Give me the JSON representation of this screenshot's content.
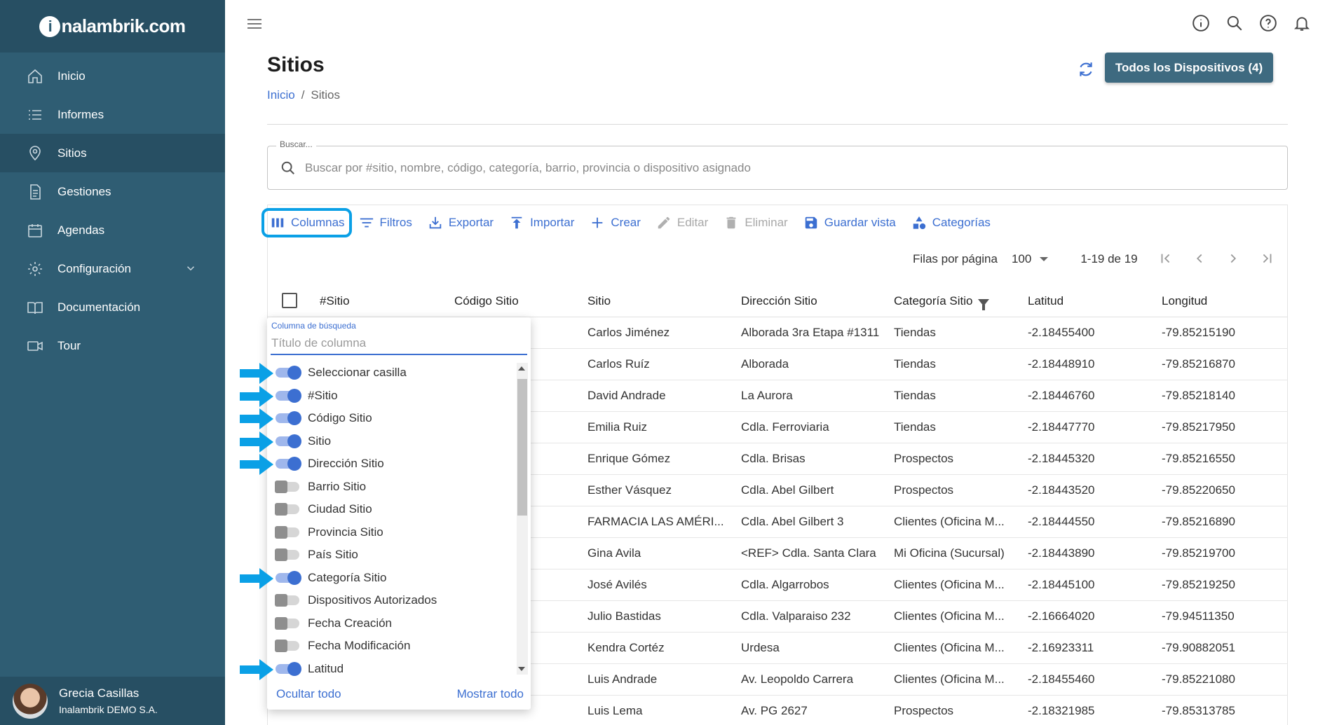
{
  "app": {
    "logo_text": "nalambrik.com",
    "logo_letter": "i"
  },
  "sidebar": {
    "items": [
      {
        "label": "Inicio",
        "icon": "home-icon"
      },
      {
        "label": "Informes",
        "icon": "list-icon"
      },
      {
        "label": "Sitios",
        "icon": "location-pin-icon",
        "active": true
      },
      {
        "label": "Gestiones",
        "icon": "document-icon"
      },
      {
        "label": "Agendas",
        "icon": "calendar-icon"
      },
      {
        "label": "Configuración",
        "icon": "gear-icon",
        "has_chevron": true
      },
      {
        "label": "Documentación",
        "icon": "book-icon"
      },
      {
        "label": "Tour",
        "icon": "video-icon"
      }
    ],
    "user": {
      "name": "Grecia Casillas",
      "company": "Inalambrik DEMO S.A."
    }
  },
  "header": {
    "title": "Sitios",
    "breadcrumb": {
      "home": "Inicio",
      "separator": "/",
      "current": "Sitios"
    },
    "devices_button": "Todos los Dispositivos (4)",
    "icons": [
      "info-icon",
      "search-icon",
      "help-icon",
      "bell-icon"
    ]
  },
  "search": {
    "label": "Buscar...",
    "placeholder": "Buscar por #sitio, nombre, código, categoría, barrio, provincia o dispositivo asignado",
    "value": ""
  },
  "toolbar": {
    "columns": "Columnas",
    "filters": "Filtros",
    "export": "Exportar",
    "import": "Importar",
    "create": "Crear",
    "edit": "Editar",
    "delete": "Eliminar",
    "save_view": "Guardar vista",
    "categories": "Categorías"
  },
  "pagination": {
    "rows_label": "Filas por página",
    "rows_value": "100",
    "range": "1-19 de 19"
  },
  "table": {
    "headers": [
      "#Sitio",
      "Código Sitio",
      "Sitio",
      "Dirección Sitio",
      "Categoría Sitio",
      "Latitud",
      "Longitud"
    ],
    "rows": [
      {
        "sitio": "Carlos Jiménez",
        "direccion": "Alborada 3ra Etapa #1311",
        "categoria": "Tiendas",
        "lat": "-2.18455400",
        "lng": "-79.85215190"
      },
      {
        "sitio": "Carlos Ruíz",
        "direccion": "Alborada",
        "categoria": "Tiendas",
        "lat": "-2.18448910",
        "lng": "-79.85216870"
      },
      {
        "sitio": "David Andrade",
        "direccion": "La Aurora",
        "categoria": "Tiendas",
        "lat": "-2.18446760",
        "lng": "-79.85218140"
      },
      {
        "sitio": "Emilia Ruiz",
        "direccion": "Cdla. Ferroviaria",
        "categoria": "Tiendas",
        "lat": "-2.18447770",
        "lng": "-79.85217950"
      },
      {
        "sitio": "Enrique Gómez",
        "direccion": "Cdla. Brisas",
        "categoria": "Prospectos",
        "lat": "-2.18445320",
        "lng": "-79.85216550"
      },
      {
        "sitio": "Esther Vásquez",
        "direccion": "Cdla. Abel Gilbert",
        "categoria": "Prospectos",
        "lat": "-2.18443520",
        "lng": "-79.85220650"
      },
      {
        "sitio": "FARMACIA LAS AMÉRI...",
        "direccion": "Cdla. Abel Gilbert 3",
        "categoria": "Clientes (Oficina M...",
        "lat": "-2.18444550",
        "lng": "-79.85216890"
      },
      {
        "sitio": "Gina Avila",
        "direccion": "<REF> Cdla. Santa Clara",
        "categoria": "Mi Oficina (Sucursal)",
        "lat": "-2.18443890",
        "lng": "-79.85219700"
      },
      {
        "sitio": "José Avilés",
        "direccion": "Cdla. Algarrobos",
        "categoria": "Clientes (Oficina M...",
        "lat": "-2.18445100",
        "lng": "-79.85219250"
      },
      {
        "sitio": "Julio Bastidas",
        "direccion": "Cdla. Valparaiso 232",
        "categoria": "Clientes (Oficina M...",
        "lat": "-2.16664020",
        "lng": "-79.94511350"
      },
      {
        "sitio": "Kendra Cortéz",
        "direccion": "Urdesa",
        "categoria": "Clientes (Oficina M...",
        "lat": "-2.16923311",
        "lng": "-79.90882051"
      },
      {
        "sitio": "Luis Andrade",
        "direccion": "Av. Leopoldo Carrera",
        "categoria": "Clientes (Oficina M...",
        "lat": "-2.18455460",
        "lng": "-79.85221080"
      },
      {
        "sitio": "Luis Lema",
        "direccion": "Av. PG 2627",
        "categoria": "Prospectos",
        "lat": "-2.18321985",
        "lng": "-79.85313785"
      }
    ]
  },
  "column_popup": {
    "label": "Columna de búsqueda",
    "placeholder": "Título de columna",
    "items": [
      {
        "label": "Seleccionar casilla",
        "on": true
      },
      {
        "label": "#Sitio",
        "on": true
      },
      {
        "label": "Código Sitio",
        "on": true
      },
      {
        "label": "Sitio",
        "on": true
      },
      {
        "label": "Dirección Sitio",
        "on": true
      },
      {
        "label": "Barrio Sitio",
        "on": false
      },
      {
        "label": "Ciudad Sitio",
        "on": false
      },
      {
        "label": "Provincia Sitio",
        "on": false
      },
      {
        "label": "País Sitio",
        "on": false
      },
      {
        "label": "Categoría Sitio",
        "on": true
      },
      {
        "label": "Dispositivos Autorizados",
        "on": false
      },
      {
        "label": "Fecha Creación",
        "on": false
      },
      {
        "label": "Fecha Modificación",
        "on": false
      },
      {
        "label": "Latitud",
        "on": true
      }
    ],
    "hide_all": "Ocultar todo",
    "show_all": "Mostrar todo"
  },
  "colors": {
    "sidebar": "#2f5d73",
    "accent": "#3c6fd1",
    "highlight": "#0aa0e6",
    "button": "#3e6a80"
  }
}
